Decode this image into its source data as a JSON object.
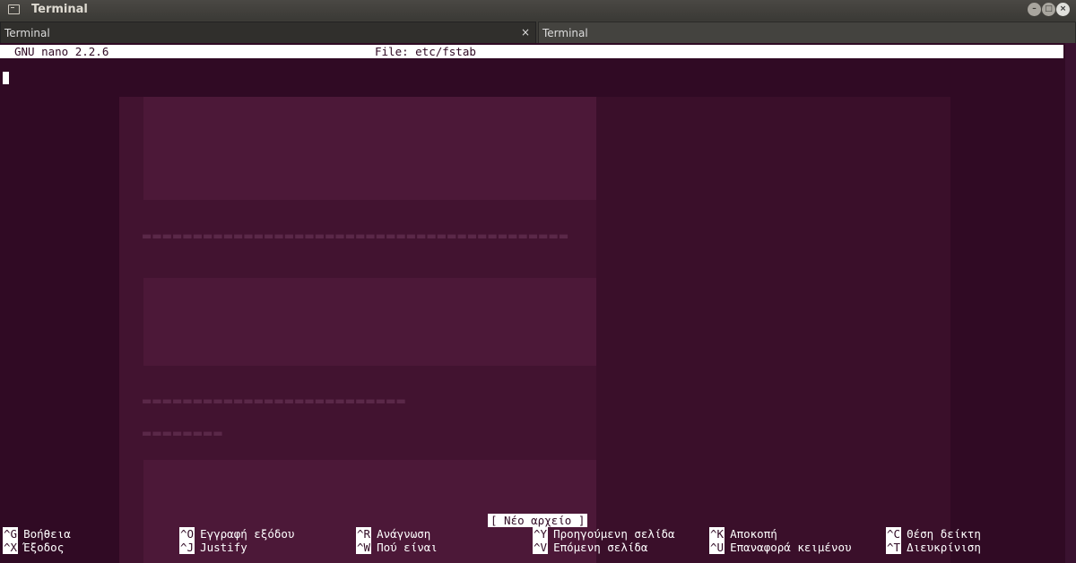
{
  "window": {
    "title": "Terminal"
  },
  "tabs": [
    {
      "label": "Terminal",
      "close": "×"
    },
    {
      "label": "Terminal"
    }
  ],
  "nano": {
    "version": "GNU nano 2.2.6",
    "file": "File: etc/fstab",
    "status": "[ Νέο αρχείο ]",
    "shortcuts_row1": [
      {
        "key": "^G",
        "label": "Βοήθεια"
      },
      {
        "key": "^O",
        "label": "Εγγραφή εξόδου"
      },
      {
        "key": "^R",
        "label": "Ανάγνωση"
      },
      {
        "key": "^Y",
        "label": "Προηγούμενη σελίδα"
      },
      {
        "key": "^K",
        "label": "Αποκοπή"
      },
      {
        "key": "^C",
        "label": "Θέση δείκτη"
      }
    ],
    "shortcuts_row2": [
      {
        "key": "^X",
        "label": "Έξοδος"
      },
      {
        "key": "^J",
        "label": "Justify"
      },
      {
        "key": "^W",
        "label": "Πού είναι"
      },
      {
        "key": "^V",
        "label": "Επόμενη σελίδα"
      },
      {
        "key": "^U",
        "label": "Επαναφορά κειμένου"
      },
      {
        "key": "^T",
        "label": "Διευκρίνιση"
      }
    ]
  },
  "colors": {
    "terminal_bg": "#300a24",
    "foreground": "#ffffff"
  }
}
